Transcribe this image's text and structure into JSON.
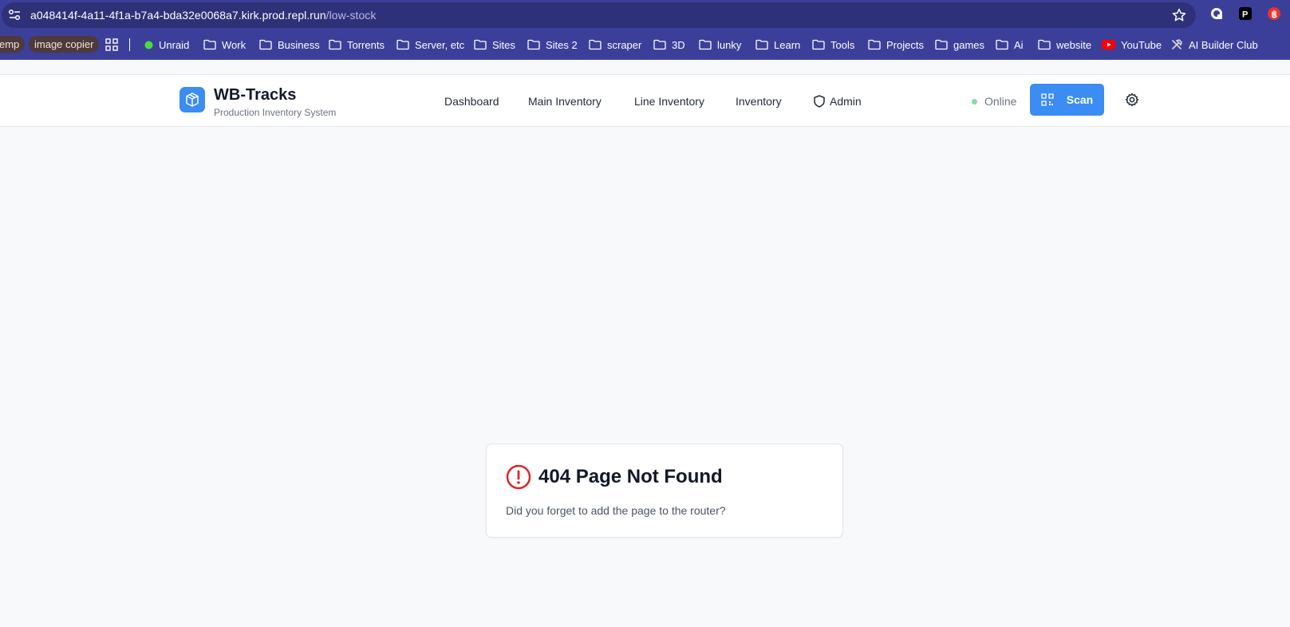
{
  "browser": {
    "url_host": "a048414f-4a11-4f1a-b7a4-bda32e0068a7.kirk.prod.repl.run",
    "url_path": "/low-stock",
    "bookmarks": [
      {
        "label": "emp",
        "kind": "pill"
      },
      {
        "label": "image copier",
        "kind": "pill"
      },
      {
        "label": "",
        "kind": "apps-icon"
      },
      {
        "label": "Unraid",
        "kind": "dot"
      },
      {
        "label": "Work",
        "kind": "folder"
      },
      {
        "label": "Business",
        "kind": "folder"
      },
      {
        "label": "Torrents",
        "kind": "folder"
      },
      {
        "label": "Server, etc",
        "kind": "folder"
      },
      {
        "label": "Sites",
        "kind": "folder"
      },
      {
        "label": "Sites 2",
        "kind": "folder"
      },
      {
        "label": "scraper",
        "kind": "folder"
      },
      {
        "label": "3D",
        "kind": "folder"
      },
      {
        "label": "lunky",
        "kind": "folder"
      },
      {
        "label": "Learn",
        "kind": "folder"
      },
      {
        "label": "Tools",
        "kind": "folder"
      },
      {
        "label": "Projects",
        "kind": "folder"
      },
      {
        "label": "games",
        "kind": "folder"
      },
      {
        "label": "Ai",
        "kind": "folder"
      },
      {
        "label": "website",
        "kind": "folder"
      },
      {
        "label": "YouTube",
        "kind": "youtube"
      },
      {
        "label": "AI Builder Club",
        "kind": "tools"
      }
    ]
  },
  "app": {
    "title": "WB-Tracks",
    "subtitle": "Production Inventory System",
    "nav": {
      "dashboard": "Dashboard",
      "main_inventory": "Main Inventory",
      "line_inventory": "Line Inventory",
      "inventory": "Inventory",
      "admin": "Admin"
    },
    "status": "Online",
    "scan_label": "Scan"
  },
  "error": {
    "title": "404 Page Not Found",
    "message": "Did you forget to add the page to the router?"
  },
  "colors": {
    "chrome": "#3c3f9a",
    "accent": "#3b8cf3",
    "error": "#dc2626",
    "online": "#86dba1"
  }
}
